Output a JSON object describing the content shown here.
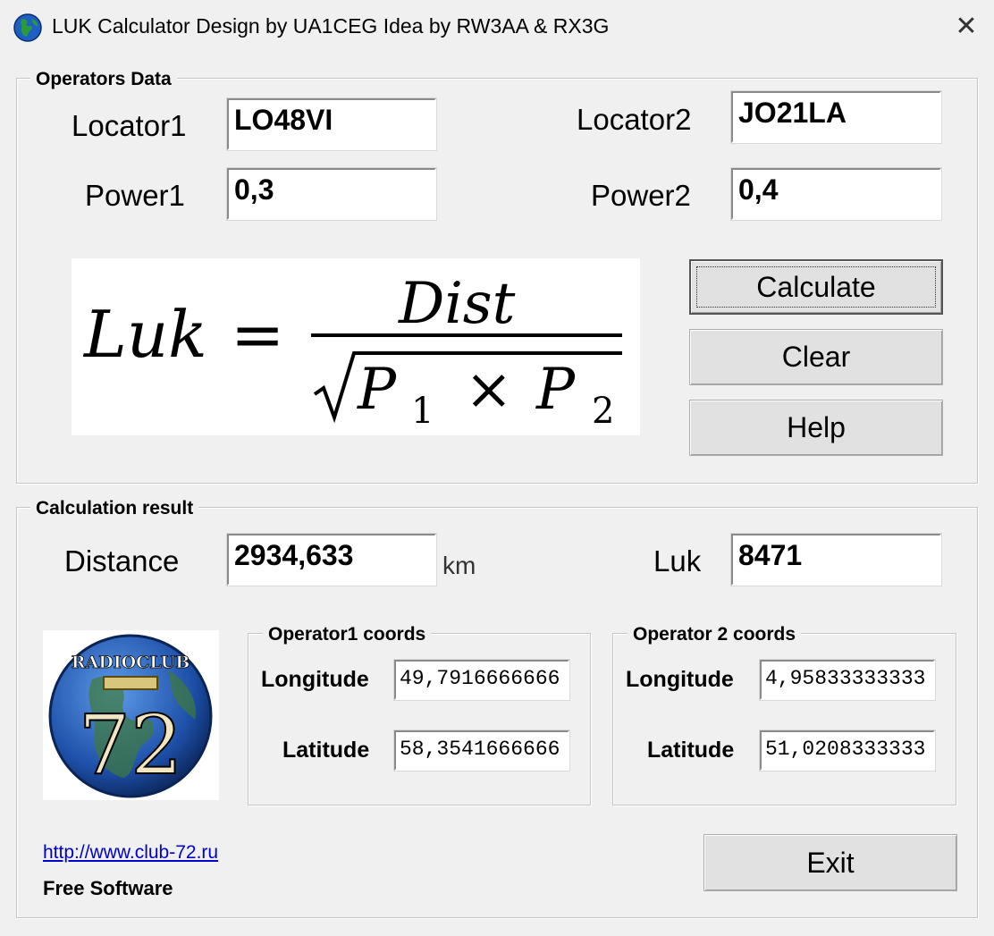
{
  "window": {
    "title": "LUK Calculator  Design by UA1CEG  Idea by RW3AA & RX3G",
    "close_label": "✕"
  },
  "operators_data": {
    "caption": "Operators Data",
    "locator1_label": "Locator1",
    "locator1_value": "LO48VI",
    "locator2_label": "Locator2",
    "locator2_value": "JO21LA",
    "power1_label": "Power1",
    "power1_value": "0,3",
    "power2_label": "Power2",
    "power2_value": "0,4"
  },
  "formula": {
    "lhs": "Luk",
    "equals": "=",
    "numerator": "Dist",
    "p1": "P",
    "p1_sub": "1",
    "times": "×",
    "p2": "P",
    "p2_sub": "2"
  },
  "buttons": {
    "calculate": "Calculate",
    "clear": "Clear",
    "help": "Help",
    "exit": "Exit"
  },
  "result": {
    "caption": "Calculation result",
    "distance_label": "Distance",
    "distance_value": "2934,633",
    "distance_unit": "km",
    "luk_label": "Luk",
    "luk_value": "8471"
  },
  "operator1_coords": {
    "caption": "Operator1 coords",
    "longitude_label": "Longitude",
    "longitude_value": "49,7916666666",
    "latitude_label": "Latitude",
    "latitude_value": "58,3541666666"
  },
  "operator2_coords": {
    "caption": "Operator 2 coords",
    "longitude_label": "Longitude",
    "longitude_value": "4,95833333333",
    "latitude_label": "Latitude",
    "latitude_value": "51,0208333333"
  },
  "logo": {
    "text_top": "RADIOCLUB",
    "number": "72"
  },
  "footer": {
    "link": "http://www.club-72.ru",
    "note": "Free Software"
  },
  "colors": {
    "window_bg": "#f0f0f0",
    "link": "#0000cc",
    "logo_blue": "#1d4fa8"
  },
  "icons": {
    "app": "globe-icon",
    "close": "close-icon"
  }
}
